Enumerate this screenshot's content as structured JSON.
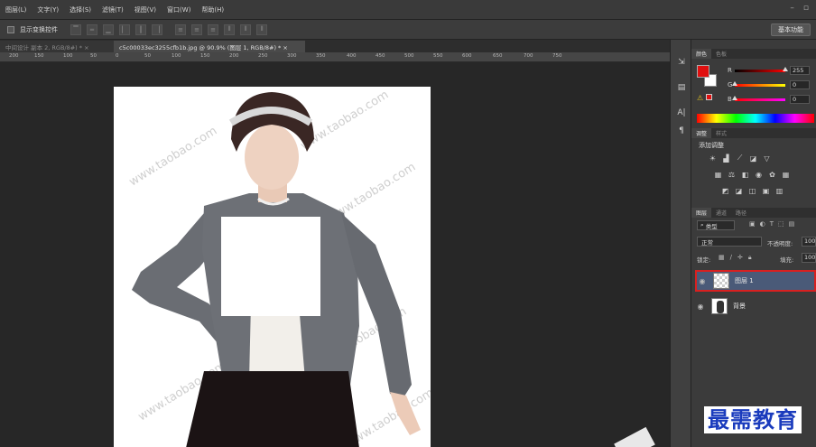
{
  "menubar": {
    "items": [
      "图层(L)",
      "文字(Y)",
      "选择(S)",
      "滤镜(T)",
      "视图(V)",
      "窗口(W)",
      "帮助(H)"
    ],
    "window_controls": [
      "–",
      "▫"
    ]
  },
  "options_bar": {
    "show_transform_controls": "显示变换控件",
    "workspace": "基本功能"
  },
  "tabs": [
    {
      "label": "中间设计 副本 2, RGB/8#) * ×",
      "active": false
    },
    {
      "label": "c5c00033ec3255cfb1b.jpg @ 90.9% (图层 1, RGB/8#) * ×",
      "active": true
    }
  ],
  "ruler": {
    "labels": [
      "200",
      "150",
      "100",
      "50",
      "0",
      "50",
      "100",
      "150",
      "200",
      "250",
      "300",
      "350",
      "400",
      "450",
      "500",
      "550",
      "600",
      "650",
      "700",
      "750"
    ]
  },
  "canvas": {
    "watermark_text": "www.taobao.com"
  },
  "color_panel": {
    "tabs": [
      "颜色",
      "色板"
    ],
    "foreground": "#e01010",
    "background": "#ffffff",
    "channels": [
      {
        "label": "R",
        "value": "255",
        "level": 1.0
      },
      {
        "label": "G",
        "value": "0",
        "level": 0.0
      },
      {
        "label": "B",
        "value": "0",
        "level": 0.0
      }
    ]
  },
  "adjustments_panel": {
    "tabs": [
      "调整",
      "样式"
    ],
    "title": "添加调整"
  },
  "layers_panel": {
    "tabs": [
      "图层",
      "通道",
      "路径"
    ],
    "filter_kind": "类型",
    "blend_mode": "正常",
    "opacity_label": "不透明度:",
    "opacity_value": "100",
    "lock_label": "锁定:",
    "fill_label": "填充:",
    "fill_value": "100",
    "layers": [
      {
        "name": "图层 1",
        "selected": true
      },
      {
        "name": "背景",
        "selected": false
      }
    ]
  },
  "brand": {
    "text": "最需教育"
  },
  "colors": {
    "accent_red": "#e01010",
    "selection_blue": "#4a5a78",
    "brand_blue": "#1a3bbd"
  }
}
